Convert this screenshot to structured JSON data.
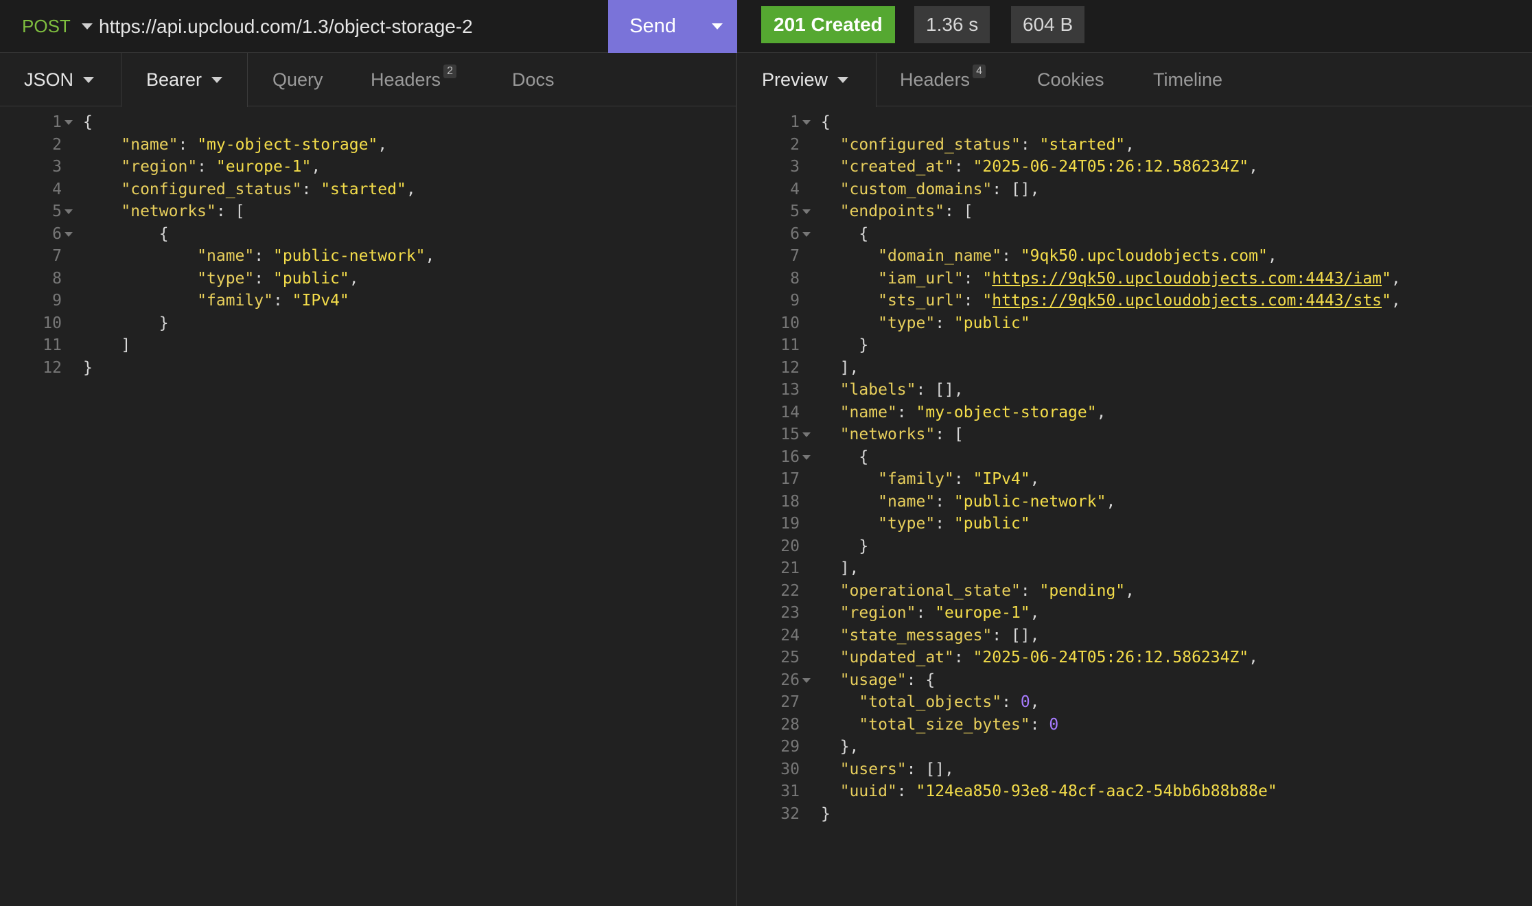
{
  "request": {
    "method": "POST",
    "url": "https://api.upcloud.com/1.3/object-storage-2",
    "send_label": "Send"
  },
  "response_meta": {
    "status": "201 Created",
    "time": "1.36 s",
    "size": "604 B"
  },
  "left_tabs": {
    "body_type": "JSON",
    "auth": "Bearer",
    "query": "Query",
    "headers": "Headers",
    "headers_count": "2",
    "docs": "Docs"
  },
  "right_tabs": {
    "preview": "Preview",
    "headers": "Headers",
    "headers_count": "4",
    "cookies": "Cookies",
    "timeline": "Timeline"
  },
  "colors": {
    "method": "#7fbf3f",
    "send": "#7a73d9",
    "status_ok": "#55a831",
    "json_string": "#f4dd4a",
    "json_number": "#a77bff"
  },
  "request_body": [
    {
      "n": "1",
      "fold": true,
      "t": [
        [
          "p",
          "{"
        ]
      ]
    },
    {
      "n": "2",
      "t": [
        [
          "p",
          "    "
        ],
        [
          "k",
          "\"name\""
        ],
        [
          "p",
          ": "
        ],
        [
          "s",
          "\"my-object-storage\""
        ],
        [
          "p",
          ","
        ]
      ]
    },
    {
      "n": "3",
      "t": [
        [
          "p",
          "    "
        ],
        [
          "k",
          "\"region\""
        ],
        [
          "p",
          ": "
        ],
        [
          "s",
          "\"europe-1\""
        ],
        [
          "p",
          ","
        ]
      ]
    },
    {
      "n": "4",
      "t": [
        [
          "p",
          "    "
        ],
        [
          "k",
          "\"configured_status\""
        ],
        [
          "p",
          ": "
        ],
        [
          "s",
          "\"started\""
        ],
        [
          "p",
          ","
        ]
      ]
    },
    {
      "n": "5",
      "fold": true,
      "t": [
        [
          "p",
          "    "
        ],
        [
          "k",
          "\"networks\""
        ],
        [
          "p",
          ": ["
        ]
      ]
    },
    {
      "n": "6",
      "fold": true,
      "t": [
        [
          "p",
          "        {"
        ]
      ]
    },
    {
      "n": "7",
      "t": [
        [
          "p",
          "            "
        ],
        [
          "k",
          "\"name\""
        ],
        [
          "p",
          ": "
        ],
        [
          "s",
          "\"public-network\""
        ],
        [
          "p",
          ","
        ]
      ]
    },
    {
      "n": "8",
      "t": [
        [
          "p",
          "            "
        ],
        [
          "k",
          "\"type\""
        ],
        [
          "p",
          ": "
        ],
        [
          "s",
          "\"public\""
        ],
        [
          "p",
          ","
        ]
      ]
    },
    {
      "n": "9",
      "t": [
        [
          "p",
          "            "
        ],
        [
          "k",
          "\"family\""
        ],
        [
          "p",
          ": "
        ],
        [
          "s",
          "\"IPv4\""
        ]
      ]
    },
    {
      "n": "10",
      "t": [
        [
          "p",
          "        }"
        ]
      ]
    },
    {
      "n": "11",
      "t": [
        [
          "p",
          "    ]"
        ]
      ]
    },
    {
      "n": "12",
      "t": [
        [
          "p",
          "}"
        ]
      ]
    }
  ],
  "response_body": [
    {
      "n": "1",
      "fold": true,
      "t": [
        [
          "p",
          "{"
        ]
      ]
    },
    {
      "n": "2",
      "t": [
        [
          "p",
          "  "
        ],
        [
          "k",
          "\"configured_status\""
        ],
        [
          "p",
          ": "
        ],
        [
          "s",
          "\"started\""
        ],
        [
          "p",
          ","
        ]
      ]
    },
    {
      "n": "3",
      "t": [
        [
          "p",
          "  "
        ],
        [
          "k",
          "\"created_at\""
        ],
        [
          "p",
          ": "
        ],
        [
          "s",
          "\"2025-06-24T05:26:12.586234Z\""
        ],
        [
          "p",
          ","
        ]
      ]
    },
    {
      "n": "4",
      "t": [
        [
          "p",
          "  "
        ],
        [
          "k",
          "\"custom_domains\""
        ],
        [
          "p",
          ": [],"
        ]
      ]
    },
    {
      "n": "5",
      "fold": true,
      "t": [
        [
          "p",
          "  "
        ],
        [
          "k",
          "\"endpoints\""
        ],
        [
          "p",
          ": ["
        ]
      ]
    },
    {
      "n": "6",
      "fold": true,
      "t": [
        [
          "p",
          "    {"
        ]
      ]
    },
    {
      "n": "7",
      "t": [
        [
          "p",
          "      "
        ],
        [
          "k",
          "\"domain_name\""
        ],
        [
          "p",
          ": "
        ],
        [
          "s",
          "\"9qk50.upcloudobjects.com\""
        ],
        [
          "p",
          ","
        ]
      ]
    },
    {
      "n": "8",
      "t": [
        [
          "p",
          "      "
        ],
        [
          "k",
          "\"iam_url\""
        ],
        [
          "p",
          ": "
        ],
        [
          "s",
          "\""
        ],
        [
          "u",
          "https://9qk50.upcloudobjects.com:4443/iam"
        ],
        [
          "s",
          "\""
        ],
        [
          "p",
          ","
        ]
      ]
    },
    {
      "n": "9",
      "t": [
        [
          "p",
          "      "
        ],
        [
          "k",
          "\"sts_url\""
        ],
        [
          "p",
          ": "
        ],
        [
          "s",
          "\""
        ],
        [
          "u",
          "https://9qk50.upcloudobjects.com:4443/sts"
        ],
        [
          "s",
          "\""
        ],
        [
          "p",
          ","
        ]
      ]
    },
    {
      "n": "10",
      "t": [
        [
          "p",
          "      "
        ],
        [
          "k",
          "\"type\""
        ],
        [
          "p",
          ": "
        ],
        [
          "s",
          "\"public\""
        ]
      ]
    },
    {
      "n": "11",
      "t": [
        [
          "p",
          "    }"
        ]
      ]
    },
    {
      "n": "12",
      "t": [
        [
          "p",
          "  ],"
        ]
      ]
    },
    {
      "n": "13",
      "t": [
        [
          "p",
          "  "
        ],
        [
          "k",
          "\"labels\""
        ],
        [
          "p",
          ": [],"
        ]
      ]
    },
    {
      "n": "14",
      "t": [
        [
          "p",
          "  "
        ],
        [
          "k",
          "\"name\""
        ],
        [
          "p",
          ": "
        ],
        [
          "s",
          "\"my-object-storage\""
        ],
        [
          "p",
          ","
        ]
      ]
    },
    {
      "n": "15",
      "fold": true,
      "t": [
        [
          "p",
          "  "
        ],
        [
          "k",
          "\"networks\""
        ],
        [
          "p",
          ": ["
        ]
      ]
    },
    {
      "n": "16",
      "fold": true,
      "t": [
        [
          "p",
          "    {"
        ]
      ]
    },
    {
      "n": "17",
      "t": [
        [
          "p",
          "      "
        ],
        [
          "k",
          "\"family\""
        ],
        [
          "p",
          ": "
        ],
        [
          "s",
          "\"IPv4\""
        ],
        [
          "p",
          ","
        ]
      ]
    },
    {
      "n": "18",
      "t": [
        [
          "p",
          "      "
        ],
        [
          "k",
          "\"name\""
        ],
        [
          "p",
          ": "
        ],
        [
          "s",
          "\"public-network\""
        ],
        [
          "p",
          ","
        ]
      ]
    },
    {
      "n": "19",
      "t": [
        [
          "p",
          "      "
        ],
        [
          "k",
          "\"type\""
        ],
        [
          "p",
          ": "
        ],
        [
          "s",
          "\"public\""
        ]
      ]
    },
    {
      "n": "20",
      "t": [
        [
          "p",
          "    }"
        ]
      ]
    },
    {
      "n": "21",
      "t": [
        [
          "p",
          "  ],"
        ]
      ]
    },
    {
      "n": "22",
      "t": [
        [
          "p",
          "  "
        ],
        [
          "k",
          "\"operational_state\""
        ],
        [
          "p",
          ": "
        ],
        [
          "s",
          "\"pending\""
        ],
        [
          "p",
          ","
        ]
      ]
    },
    {
      "n": "23",
      "t": [
        [
          "p",
          "  "
        ],
        [
          "k",
          "\"region\""
        ],
        [
          "p",
          ": "
        ],
        [
          "s",
          "\"europe-1\""
        ],
        [
          "p",
          ","
        ]
      ]
    },
    {
      "n": "24",
      "t": [
        [
          "p",
          "  "
        ],
        [
          "k",
          "\"state_messages\""
        ],
        [
          "p",
          ": [],"
        ]
      ]
    },
    {
      "n": "25",
      "t": [
        [
          "p",
          "  "
        ],
        [
          "k",
          "\"updated_at\""
        ],
        [
          "p",
          ": "
        ],
        [
          "s",
          "\"2025-06-24T05:26:12.586234Z\""
        ],
        [
          "p",
          ","
        ]
      ]
    },
    {
      "n": "26",
      "fold": true,
      "t": [
        [
          "p",
          "  "
        ],
        [
          "k",
          "\"usage\""
        ],
        [
          "p",
          ": {"
        ]
      ]
    },
    {
      "n": "27",
      "t": [
        [
          "p",
          "    "
        ],
        [
          "k",
          "\"total_objects\""
        ],
        [
          "p",
          ": "
        ],
        [
          "n",
          "0"
        ],
        [
          "p",
          ","
        ]
      ]
    },
    {
      "n": "28",
      "t": [
        [
          "p",
          "    "
        ],
        [
          "k",
          "\"total_size_bytes\""
        ],
        [
          "p",
          ": "
        ],
        [
          "n",
          "0"
        ]
      ]
    },
    {
      "n": "29",
      "t": [
        [
          "p",
          "  },"
        ]
      ]
    },
    {
      "n": "30",
      "t": [
        [
          "p",
          "  "
        ],
        [
          "k",
          "\"users\""
        ],
        [
          "p",
          ": [],"
        ]
      ]
    },
    {
      "n": "31",
      "t": [
        [
          "p",
          "  "
        ],
        [
          "k",
          "\"uuid\""
        ],
        [
          "p",
          ": "
        ],
        [
          "s",
          "\"124ea850-93e8-48cf-aac2-54bb6b88b88e\""
        ]
      ]
    },
    {
      "n": "32",
      "t": [
        [
          "p",
          "}"
        ]
      ]
    }
  ]
}
